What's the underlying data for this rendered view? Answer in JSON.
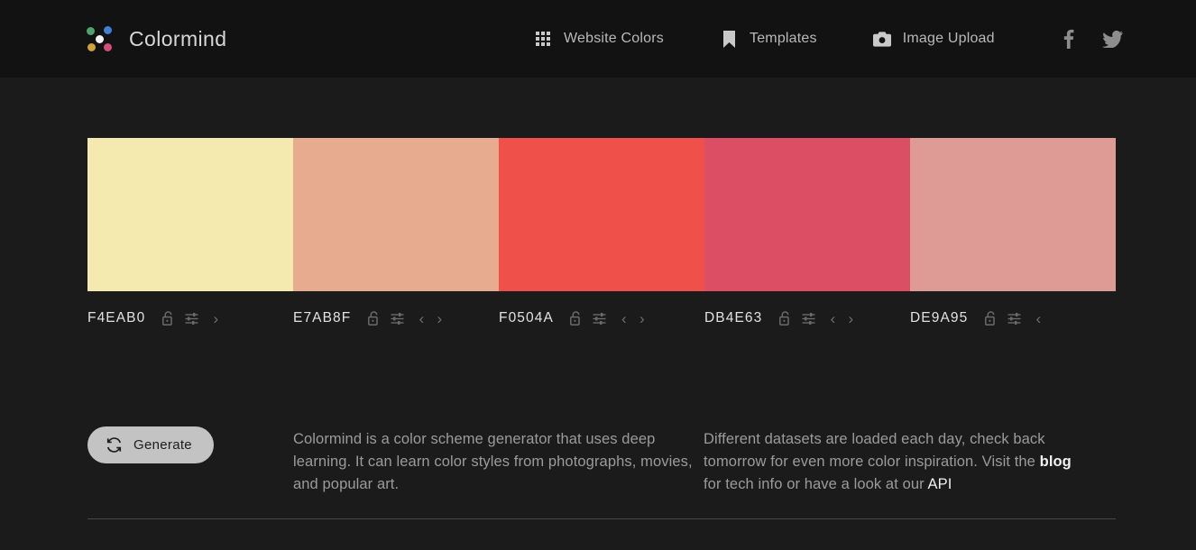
{
  "header": {
    "brand_name": "Colormind",
    "logo_icon": "colormind-dots-logo",
    "nav": [
      {
        "label": "Website Colors",
        "icon": "grid-icon"
      },
      {
        "label": "Templates",
        "icon": "bookmark-icon"
      },
      {
        "label": "Image Upload",
        "icon": "camera-icon"
      }
    ],
    "social": [
      {
        "name": "facebook-icon",
        "label": "f"
      },
      {
        "name": "twitter-icon",
        "label": "twitter"
      }
    ]
  },
  "palette": {
    "swatches": [
      {
        "hex": "F4EAB0",
        "color": "#F4EAB0",
        "locked": false,
        "has_prev": false,
        "has_next": true
      },
      {
        "hex": "E7AB8F",
        "color": "#E7AB8F",
        "locked": false,
        "has_prev": true,
        "has_next": true
      },
      {
        "hex": "F0504A",
        "color": "#F0504A",
        "locked": false,
        "has_prev": true,
        "has_next": true
      },
      {
        "hex": "DB4E63",
        "color": "#DB4E63",
        "locked": false,
        "has_prev": true,
        "has_next": true
      },
      {
        "hex": "DE9A95",
        "color": "#DE9A95",
        "locked": false,
        "has_prev": true,
        "has_next": false
      }
    ],
    "controls": {
      "lock_icon": "unlocked-padlock-icon",
      "adjust_icon": "sliders-icon",
      "prev_icon": "chevron-left-icon",
      "next_icon": "chevron-right-icon"
    }
  },
  "actions": {
    "generate_label": "Generate",
    "generate_icon": "refresh-icon"
  },
  "about": {
    "paragraph_left": "Colormind is a color scheme generator that uses deep learning. It can learn color styles from photographs, movies, and popular art.",
    "paragraph_right_part1": "Different datasets are loaded each day, check back tomorrow for even more color inspiration. Visit the ",
    "link_blog": "blog",
    "paragraph_right_part2": " for tech info or have a look at our ",
    "link_api": "API"
  },
  "theme": {
    "header_bg": "#121212",
    "body_bg": "#1b1b1b",
    "text": "#9b9b9b",
    "button_bg": "#c3c3c3"
  }
}
